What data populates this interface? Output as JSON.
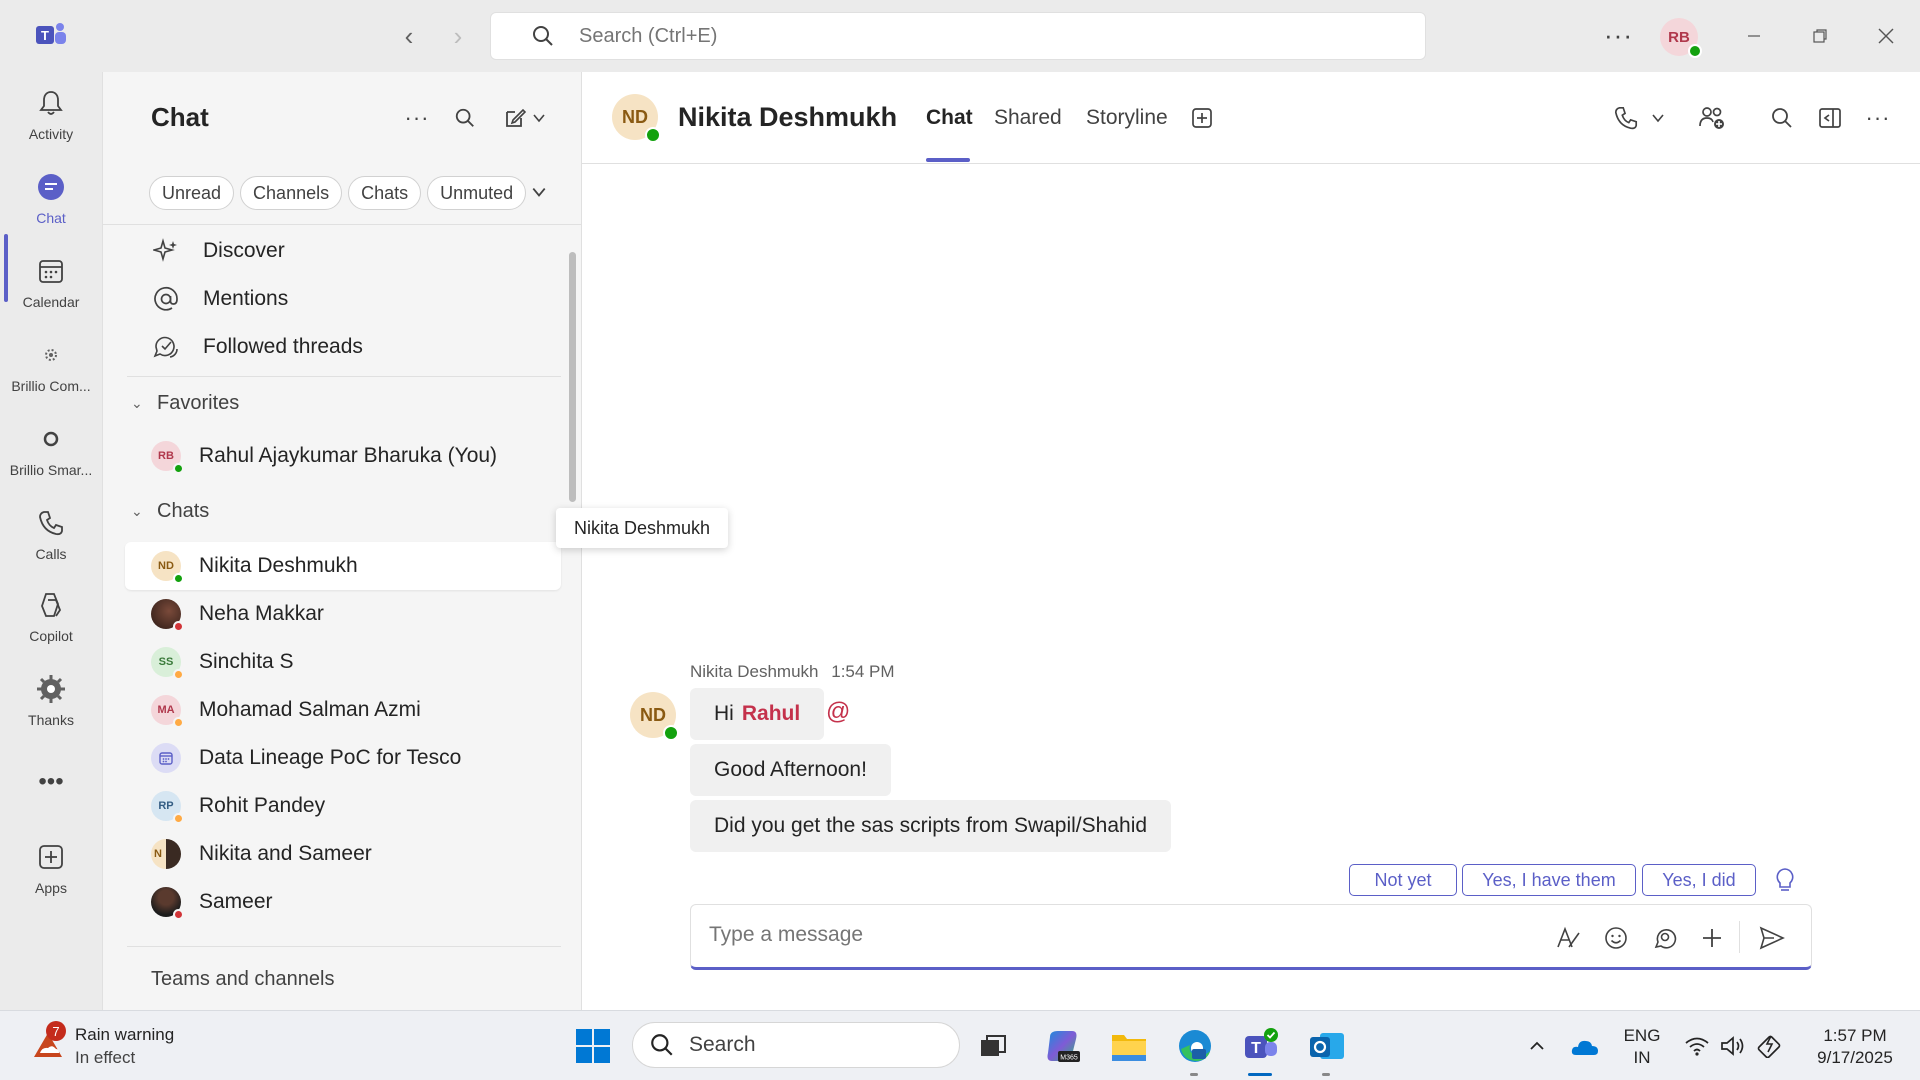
{
  "titlebar": {
    "search_placeholder": "Search (Ctrl+E)",
    "user_initials": "RB"
  },
  "rail": {
    "items": [
      {
        "label": "Activity",
        "icon": "bell-icon"
      },
      {
        "label": "Chat",
        "icon": "chat-icon"
      },
      {
        "label": "Calendar",
        "icon": "calendar-icon"
      },
      {
        "label": "Brillio Com...",
        "icon": "app-icon"
      },
      {
        "label": "Brillio Smar...",
        "icon": "app-icon"
      },
      {
        "label": "Calls",
        "icon": "phone-icon"
      },
      {
        "label": "Copilot",
        "icon": "copilot-icon"
      },
      {
        "label": "Thanks",
        "icon": "thanks-icon"
      },
      {
        "label": "Apps",
        "icon": "add-app-icon"
      }
    ],
    "more": "•••"
  },
  "panel": {
    "title": "Chat",
    "filters": [
      "Unread",
      "Channels",
      "Chats",
      "Unmuted"
    ],
    "nav": [
      {
        "label": "Discover",
        "icon": "sparkle-icon"
      },
      {
        "label": "Mentions",
        "icon": "at-icon"
      },
      {
        "label": "Followed threads",
        "icon": "threads-icon"
      }
    ],
    "favorites_header": "Favorites",
    "favorites": [
      {
        "name": "Rahul Ajaykumar Bharuka (You)",
        "initials": "RB"
      }
    ],
    "chats_header": "Chats",
    "chats": [
      {
        "name": "Nikita Deshmukh",
        "initials": "ND"
      },
      {
        "name": "Neha Makkar",
        "initials": ""
      },
      {
        "name": "Sinchita S",
        "initials": "SS"
      },
      {
        "name": "Mohamad Salman Azmi",
        "initials": "MA"
      },
      {
        "name": "Data Lineage PoC for Tesco",
        "initials": ""
      },
      {
        "name": "Rohit Pandey",
        "initials": "RP"
      },
      {
        "name": "Nikita and Sameer",
        "initials": "N"
      },
      {
        "name": "Sameer",
        "initials": ""
      }
    ],
    "teams_channels": "Teams and channels"
  },
  "tooltip": "Nikita Deshmukh",
  "conversation": {
    "initials": "ND",
    "name": "Nikita Deshmukh",
    "tabs": [
      "Chat",
      "Shared",
      "Storyline"
    ],
    "message_sender": "Nikita Deshmukh",
    "message_time": "1:54 PM",
    "messages": [
      {
        "prefix": "Hi",
        "mention": "Rahul"
      },
      {
        "text": "Good Afternoon!"
      },
      {
        "text": "Did you get the sas scripts from Swapil/Shahid"
      }
    ],
    "suggested_replies": [
      "Not yet",
      "Yes, I have them",
      "Yes, I did"
    ],
    "composer_placeholder": "Type a message"
  },
  "taskbar": {
    "weather_title": "Rain warning",
    "weather_sub": "In effect",
    "weather_badge": "7",
    "search": "Search",
    "lang1": "ENG",
    "lang2": "IN",
    "time": "1:57 PM",
    "date": "9/17/2025"
  },
  "colors": {
    "accent": "#5b5fc7",
    "mention": "#c4314b",
    "available": "#13a10e"
  }
}
